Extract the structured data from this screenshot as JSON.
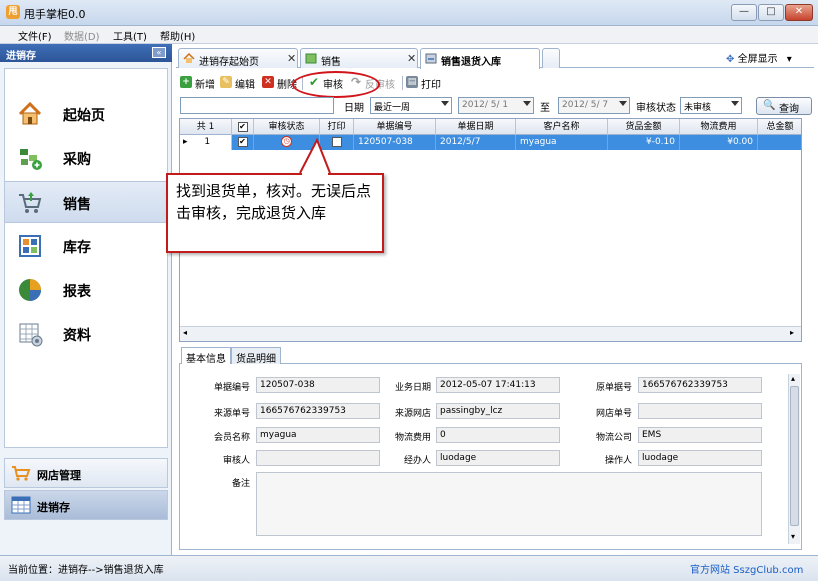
{
  "window": {
    "title": "甩手掌柜0.0",
    "controls": [
      "—",
      "□",
      "✕"
    ]
  },
  "menu": {
    "items": [
      {
        "label": "文件(F)",
        "disabled": false
      },
      {
        "label": "数据(D)",
        "disabled": true
      },
      {
        "label": "工具(T)",
        "disabled": false
      },
      {
        "label": "帮助(H)",
        "disabled": false
      }
    ]
  },
  "sidebar": {
    "title": "进销存",
    "collapse_icon": "«",
    "items": [
      {
        "label": "起始页",
        "icon": "home-icon"
      },
      {
        "label": "采购",
        "icon": "purchase-icon"
      },
      {
        "label": "销售",
        "icon": "cart-icon",
        "active": true
      },
      {
        "label": "库存",
        "icon": "inventory-icon"
      },
      {
        "label": "报表",
        "icon": "pie-chart-icon"
      },
      {
        "label": "资料",
        "icon": "data-icon"
      }
    ],
    "bottom": [
      {
        "label": "网店管理",
        "icon": "shop-cart-icon"
      },
      {
        "label": "进销存",
        "icon": "table-icon",
        "active": true
      }
    ]
  },
  "tabs": [
    {
      "label": "进销存起始页",
      "close": "✕"
    },
    {
      "label": "销售",
      "close": "✕"
    },
    {
      "label": "销售退货入库",
      "close": "✕",
      "active": true
    }
  ],
  "fullscreen": {
    "label": "全屏显示",
    "arrow": "▾"
  },
  "toolbar": {
    "new": "新增",
    "edit": "编辑",
    "delete": "删除",
    "approve": "审核",
    "unapprove": "反审核",
    "print": "打印"
  },
  "filter": {
    "date_label": "日期",
    "date_range": "最近一周",
    "date_from": "2012/ 5/ 1",
    "to_label": "至",
    "date_to": "2012/ 5/ 7",
    "status_label": "审核状态",
    "status_value": "未审核",
    "query": "查询"
  },
  "grid": {
    "headers": [
      "共 1",
      "☑",
      "审核状态",
      "打印",
      "单据编号",
      "单据日期",
      "客户名称",
      "货品金额",
      "物流费用",
      "总金额"
    ],
    "rows": [
      {
        "index": "1",
        "bill_no": "120507-038",
        "bill_date": "2012/5/7",
        "customer": "myagua",
        "goods_amount": "¥-0.10",
        "logistics_fee": "¥0.00"
      }
    ]
  },
  "callout": {
    "text": "找到退货单，核对。无误后点击审核，完成退货入库"
  },
  "detail": {
    "tabs": [
      "基本信息",
      "货品明细"
    ],
    "fields": {
      "bill_no_label": "单据编号",
      "bill_no": "120507-038",
      "biz_date_label": "业务日期",
      "biz_date": "2012-05-07 17:41:13",
      "orig_no_label": "原单据号",
      "orig_no": "166576762339753",
      "source_no_label": "来源单号",
      "source_no": "166576762339753",
      "source_shop_label": "来源网店",
      "source_shop": "passingby_lcz",
      "shop_no_label": "网店单号",
      "shop_no": "",
      "member_label": "会员名称",
      "member": "myagua",
      "logistics_fee_label": "物流费用",
      "logistics_fee": "0",
      "logistics_co_label": "物流公司",
      "logistics_co": "EMS",
      "reviewer_label": "审核人",
      "reviewer": "",
      "handler_label": "经办人",
      "handler": "luodage",
      "operator_label": "操作人",
      "operator": "luodage",
      "remark_label": "备注",
      "remark": ""
    }
  },
  "status": {
    "location": "当前位置：进销存-->销售退货入库",
    "link": "官方网站 SszgClub.com"
  }
}
